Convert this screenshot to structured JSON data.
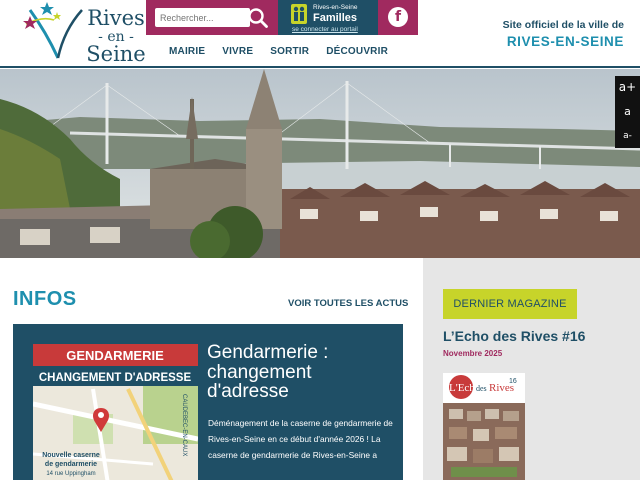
{
  "header": {
    "logo": {
      "line1": "Rives",
      "line2": "- en -",
      "line3": "Seine"
    },
    "search": {
      "placeholder": "Rechercher..."
    },
    "familles": {
      "small": "Rives-en-Seine",
      "big": "Familles",
      "link": "se connecter au portail"
    },
    "facebook": {
      "glyph": "f"
    },
    "nav": [
      "MAIRIE",
      "VIVRE",
      "SORTIR",
      "DÉCOUVRIR"
    ],
    "tagline": {
      "line1": "Site officiel de la ville de",
      "line2": "RIVES-EN-SEINE"
    }
  },
  "accessibility": {
    "increase": "a+",
    "normal": "a",
    "decrease": "a-"
  },
  "infos": {
    "title": "INFOS",
    "see_all": "VOIR TOUTES LES ACTUS",
    "article": {
      "image_banner_1": "GENDARMERIE",
      "image_banner_2": "CHANGEMENT D'ADRESSE",
      "image_caption_1": "Nouvelle caserne",
      "image_caption_2": "de gendarmerie",
      "image_caption_3": "14 rue Uppingham",
      "image_map_road": "CAUDEBEC-EN-CAUX",
      "heading": "Gendarmerie : changement d'adresse",
      "text": "Déménagement de la caserne de gendarmerie de Rives-en-Seine en ce début d'année 2026 ! La caserne de gendarmerie de Rives-en-Seine a"
    }
  },
  "magazine": {
    "label": "DERNIER MAGAZINE",
    "title": "L’Echo des Rives #16",
    "date": "Novembre 2025",
    "cover_word_1": "L'Echo",
    "cover_word_2": "des",
    "cover_word_3": "Rives",
    "cover_issue": "16"
  },
  "colors": {
    "navy": "#1f4f66",
    "teal": "#1e8fae",
    "magenta": "#a02a5f",
    "lime": "#c7d42a",
    "sidebar_bg": "#e6e6e6"
  },
  "icons": [
    "logo-stars-icon",
    "search-icon",
    "family-icon",
    "facebook-icon"
  ]
}
